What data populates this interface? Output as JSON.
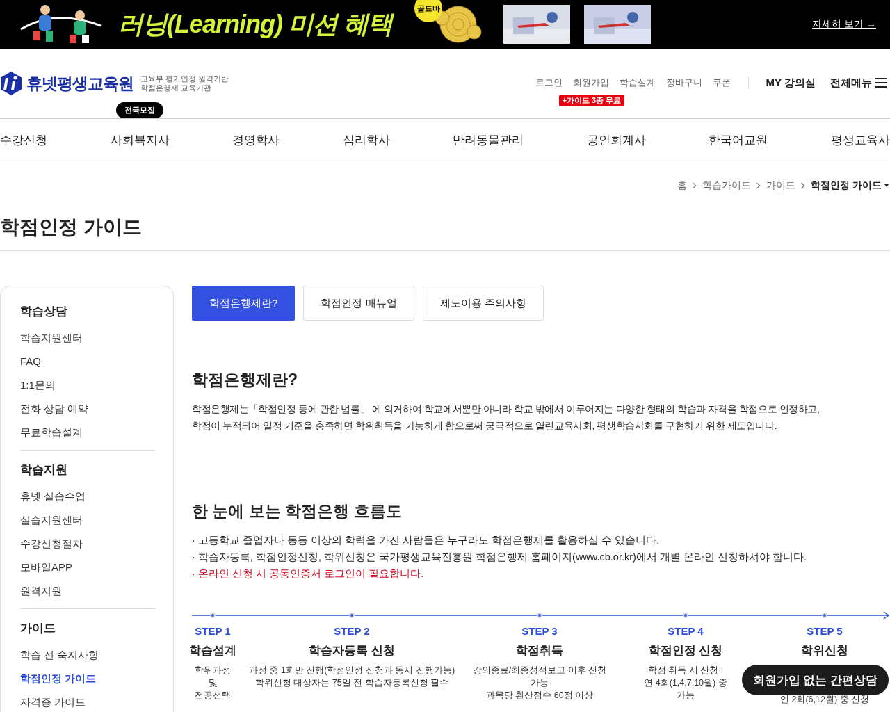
{
  "banner": {
    "title": "러닝(Learning) 미션 혜택",
    "badge": "골드바",
    "link": "자세히 보기 →"
  },
  "header": {
    "logo_name": "휴넷평생교육원",
    "logo_tagline": [
      "교육부 평가인정 원격기반",
      "학점은행제 교육기관"
    ],
    "util_links": [
      "로그인",
      "회원가입",
      "학습설계",
      "장바구니",
      "쿠폰"
    ],
    "promo_tag": "+가이드 3종 무료",
    "my_link": "MY 강의실",
    "menu_label": "전체메뉴"
  },
  "nav": [
    {
      "label": "수강신청"
    },
    {
      "label": "사회복지사",
      "badge": "전국모집"
    },
    {
      "label": "경영학사"
    },
    {
      "label": "심리학사"
    },
    {
      "label": "반려동물관리"
    },
    {
      "label": "공인회계사"
    },
    {
      "label": "한국어교원"
    },
    {
      "label": "평생교육사"
    }
  ],
  "breadcrumb": [
    "홈",
    "학습가이드",
    "가이드",
    "학점인정 가이드"
  ],
  "page_title": "학점인정 가이드",
  "sidebar": [
    {
      "title": "학습상담",
      "items": [
        {
          "label": "학습지원센터",
          "selected": false
        },
        {
          "label": "FAQ",
          "selected": false
        },
        {
          "label": "1:1문의",
          "selected": false
        },
        {
          "label": "전화 상담 예약",
          "selected": false
        },
        {
          "label": "무료학습설계",
          "selected": false
        }
      ]
    },
    {
      "title": "학습지원",
      "items": [
        {
          "label": "휴넷 실습수업",
          "selected": false
        },
        {
          "label": "실습지원센터",
          "selected": false
        },
        {
          "label": "수강신청절차",
          "selected": false
        },
        {
          "label": "모바일APP",
          "selected": false
        },
        {
          "label": "원격지원",
          "selected": false
        }
      ]
    },
    {
      "title": "가이드",
      "items": [
        {
          "label": "학습 전 숙지사항",
          "selected": false
        },
        {
          "label": "학점인정 가이드",
          "selected": true
        },
        {
          "label": "자격증 가이드",
          "selected": false
        }
      ]
    }
  ],
  "tabs": [
    {
      "label": "학점은행제란?",
      "selected": true
    },
    {
      "label": "학점인정 매뉴얼",
      "selected": false
    },
    {
      "label": "제도이용 주의사항",
      "selected": false
    }
  ],
  "intro": {
    "title": "학점은행제란?",
    "lines": [
      "학점은행제는「학점인정 등에 관한 법률」 에 의거하여 학교에서뿐만 아니라 학교 밖에서 이루어지는 다양한 형태의 학습과 자격을 학점으로 인정하고,",
      "학점이 누적되어 일정 기준을 충족하면 학위취득을 가능하게 함으로써 궁극적으로 열린교육사회, 평생학습사회를 구현하기 위한 제도입니다."
    ]
  },
  "flow": {
    "title": "한 눈에 보는 학점은행 흐름도",
    "bullets": [
      {
        "text": "· 고등학교 졸업자나 동등 이상의 학력을 가진 사람들은 누구라도 학점은행제를 활용하실 수 있습니다.",
        "kind": "normal"
      },
      {
        "text": "· 학습자등록, 학점인정신청, 학위신청은 국가평생교육진흥원 학점은행제 홈페이지(www.cb.or.kr)에서 개별 온라인 신청하셔야 합니다.",
        "kind": "normal"
      },
      {
        "text": "· 온라인 신청 시 공동인증서 로그인이 필요합니다.",
        "kind": "alert"
      }
    ],
    "steps": [
      {
        "step": "STEP 1",
        "title": "학습설계",
        "lines": [
          "학위과정",
          "및",
          "전공선택"
        ]
      },
      {
        "step": "STEP 2",
        "title": "학습자등록 신청",
        "lines": [
          "과정 중 1회만 진행(학점인정 신청과 동시 진행가능)",
          "학위신청 대상자는 75일 전 학습자등록신청 필수"
        ]
      },
      {
        "step": "STEP 3",
        "title": "학점취득",
        "lines": [
          "강의종료/최종성적보고 이후 신청가능",
          "과목당 환산점수 60점 이상"
        ]
      },
      {
        "step": "STEP 4",
        "title": "학점인정 신청",
        "lines": [
          "학점 취득 시 신청 :",
          "연 4회(1,4,7,10월) 중",
          "가능"
        ]
      },
      {
        "step": "STEP 5",
        "title": "학위신청",
        "lines": [
          "연 2회(6,12월) 중 신청"
        ]
      }
    ]
  },
  "floating_button": "회원가입 없는 간편상담"
}
